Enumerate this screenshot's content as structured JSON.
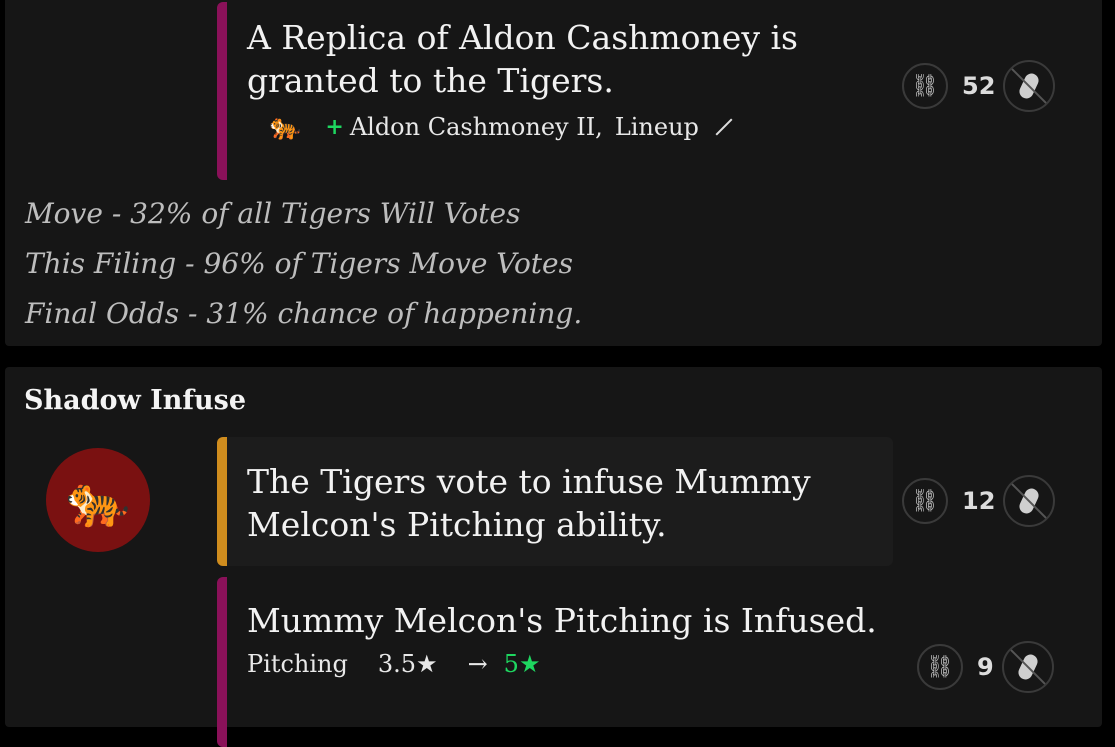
{
  "card1": {
    "event_text": "A Replica of Aldon Cashmoney is granted to the Tigers.",
    "changes": {
      "team_icon": "🐅",
      "plus": "+",
      "player": "Aldon Cashmoney II,",
      "location": "Lineup"
    },
    "count": "52",
    "odds": [
      "Move - 32% of all Tigers Will Votes",
      "This Filing - 96% of Tigers Move Votes",
      "Final Odds - 31% chance of happening."
    ]
  },
  "card2": {
    "title": "Shadow Infuse",
    "team_icon": "🐅",
    "event1": {
      "text": "The Tigers vote to infuse Mummy Melcon's Pitching ability.",
      "count": "12"
    },
    "event2": {
      "text": "Mummy Melcon's Pitching is Infused.",
      "count": "9",
      "stat_label": "Pitching",
      "stat_from": "3.5★",
      "arrow": "→",
      "stat_to": "5★"
    }
  },
  "icons": {
    "link": "🔗",
    "link_icon": "link-icon",
    "peanut_icon": "peanut-icon"
  },
  "colors": {
    "accent_purple": "#8a1159",
    "accent_gold": "#d08d1e",
    "plus_green": "#1ed760",
    "logo_red": "#7a1111"
  }
}
